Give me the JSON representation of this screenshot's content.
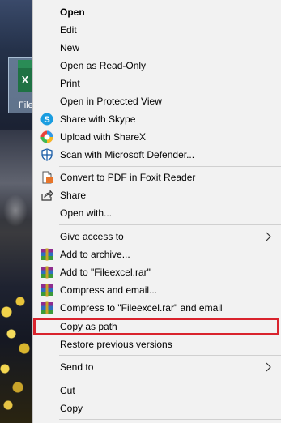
{
  "desktop": {
    "file_caption": "File"
  },
  "menu": {
    "items": [
      {
        "label": "Open",
        "icon": "none",
        "bold": true
      },
      {
        "label": "Edit",
        "icon": "none"
      },
      {
        "label": "New",
        "icon": "none"
      },
      {
        "label": "Open as Read-Only",
        "icon": "none"
      },
      {
        "label": "Print",
        "icon": "none"
      },
      {
        "label": "Open in Protected View",
        "icon": "none"
      },
      {
        "label": "Share with Skype",
        "icon": "skype-icon"
      },
      {
        "label": "Upload with ShareX",
        "icon": "sharex-icon"
      },
      {
        "label": "Scan with Microsoft Defender...",
        "icon": "defender-shield-icon"
      },
      {
        "label": "Convert to PDF in Foxit Reader",
        "icon": "foxit-pdf-icon"
      },
      {
        "label": "Share",
        "icon": "share-icon"
      },
      {
        "label": "Open with...",
        "icon": "none"
      },
      {
        "label": "Give access to",
        "icon": "none",
        "submenu": true
      },
      {
        "label": "Add to archive...",
        "icon": "winrar-icon"
      },
      {
        "label": "Add to \"Fileexcel.rar\"",
        "icon": "winrar-icon"
      },
      {
        "label": "Compress and email...",
        "icon": "winrar-icon"
      },
      {
        "label": "Compress to \"Fileexcel.rar\" and email",
        "icon": "winrar-icon"
      },
      {
        "label": "Copy as path",
        "icon": "none",
        "highlighted": true
      },
      {
        "label": "Restore previous versions",
        "icon": "none"
      },
      {
        "label": "Send to",
        "icon": "none",
        "submenu": true
      },
      {
        "label": "Cut",
        "icon": "none"
      },
      {
        "label": "Copy",
        "icon": "none"
      }
    ]
  },
  "colors": {
    "menu_bg": "#f2f2f2",
    "highlight_border": "#d9232d",
    "excel_green": "#1f7244"
  }
}
